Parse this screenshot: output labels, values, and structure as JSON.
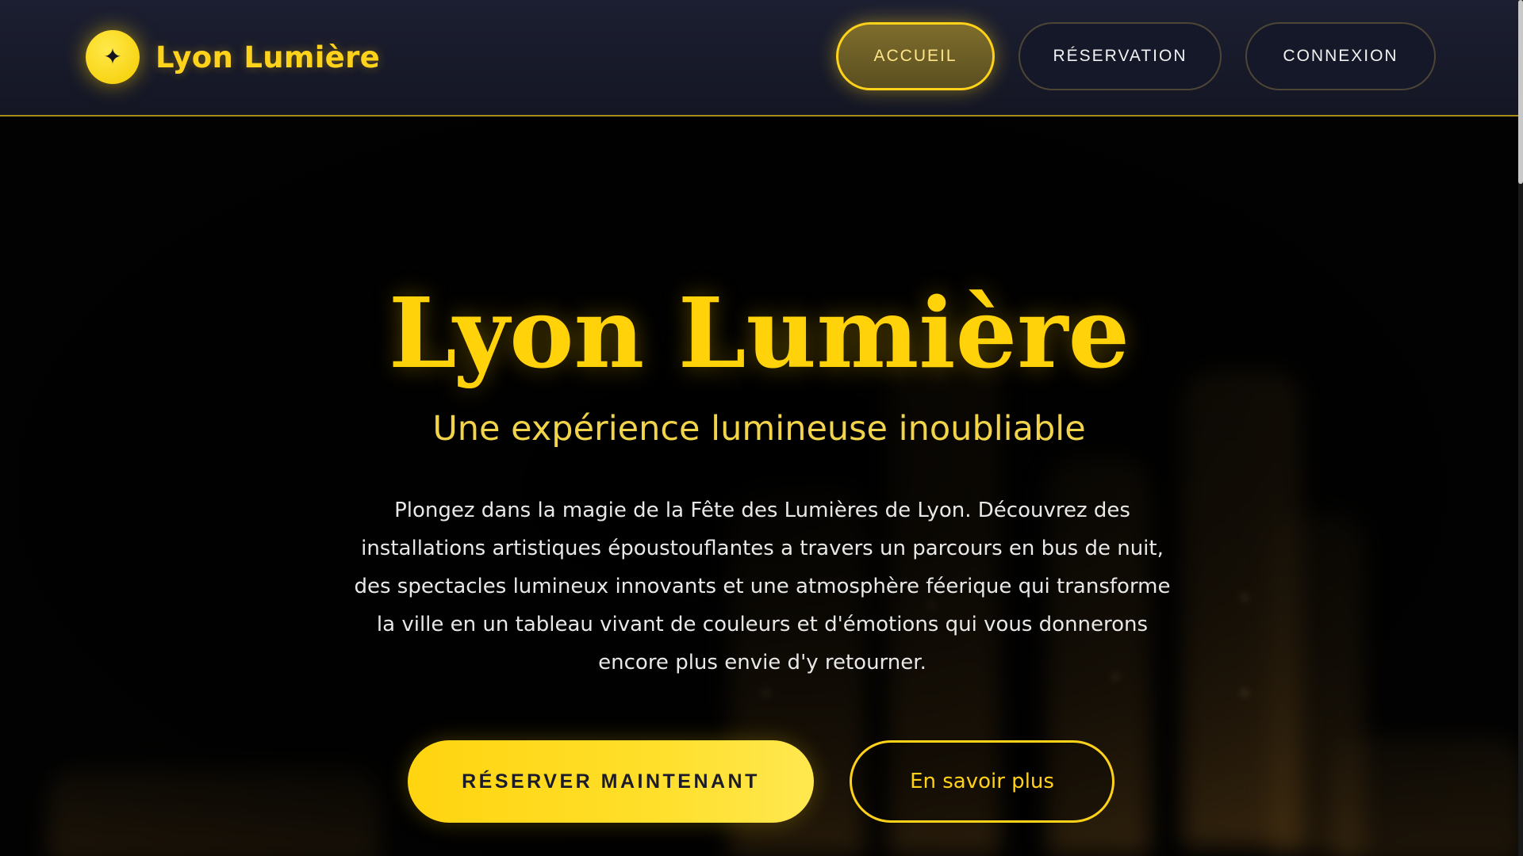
{
  "header": {
    "logo_icon": "sparkle-icon",
    "logo_glyph": "✦",
    "logo_text": "Lyon Lumière",
    "nav": [
      {
        "label": "ACCUEIL",
        "active": true
      },
      {
        "label": "RÉSERVATION",
        "active": false
      },
      {
        "label": "CONNEXION",
        "active": false
      }
    ]
  },
  "hero": {
    "title": "Lyon Lumière",
    "subtitle": "Une expérience lumineuse inoubliable",
    "description": "Plongez dans la magie de la Fête des Lumières de Lyon. Découvrez des installations artistiques époustouflantes a travers un parcours en bus de nuit, des spectacles lumineux innovants et une atmosphère féerique qui transforme la ville en un tableau vivant de couleurs et d'émotions qui vous donnerons encore plus envie d'y retourner.",
    "primary_cta": "RÉSERVER MAINTENANT",
    "secondary_cta": "En savoir plus"
  },
  "colors": {
    "accent": "#ffd21a",
    "header_bg": "#1a1d2e",
    "page_bg": "#030303"
  }
}
